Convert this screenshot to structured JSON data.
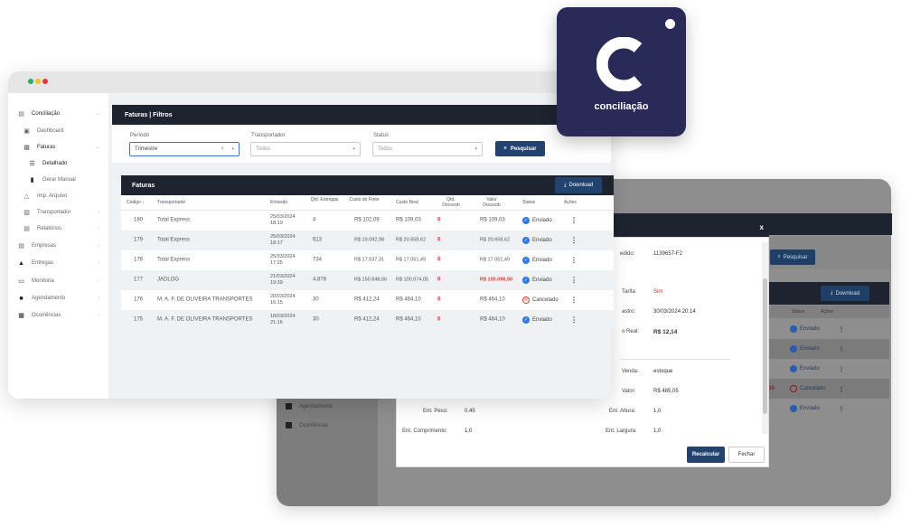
{
  "logo": {
    "text": "conciliação"
  },
  "sidebar": {
    "items": [
      {
        "label": "Conciliação",
        "icon": "ledger-icon"
      },
      {
        "label": "Dashboard",
        "icon": "dashboard-icon"
      },
      {
        "label": "Faturas",
        "icon": "folder-icon"
      },
      {
        "label": "Detalhado",
        "icon": "list-icon"
      },
      {
        "label": "Gerar Manual",
        "icon": "document-icon"
      },
      {
        "label": "Imp. Arquivo",
        "icon": "upload-icon"
      },
      {
        "label": "Transportador",
        "icon": "truck-icon"
      },
      {
        "label": "Relatórios",
        "icon": "report-icon"
      },
      {
        "label": "Empresas",
        "icon": "building-icon"
      },
      {
        "label": "Entregas",
        "icon": "delivery-icon"
      },
      {
        "label": "Monitoria",
        "icon": "monitor-icon"
      },
      {
        "label": "Agendamento",
        "icon": "calendar-icon"
      },
      {
        "label": "Ocorrências",
        "icon": "grid-icon"
      }
    ]
  },
  "filters": {
    "title": "Faturas | Filtros",
    "periodo_label": "Período",
    "periodo_value": "Trimestre",
    "transportador_label": "Transportador",
    "transportador_value": "Todos",
    "status_label": "Status",
    "status_value": "Todos",
    "search_button": "Pesquisar"
  },
  "faturas": {
    "title": "Faturas",
    "download_button": "Download",
    "columns": [
      "Codigo",
      "Transportador",
      "Emissão",
      "Qtd. Entregas",
      "Custo do Frete",
      "Custo Real",
      "Qtd. Docscob",
      "Valor Docscob",
      "Status",
      "Ações"
    ],
    "rows": [
      {
        "codigo": "180",
        "transportador": "Total Express",
        "emissao": "25/03/2024 18:19",
        "qtd": "4",
        "custo_frete": "R$ 102,09",
        "custo_real": "R$ 109,03",
        "docs": "0",
        "valor": "R$ 109,03",
        "status": "Enviado"
      },
      {
        "codigo": "179",
        "transportador": "Total Express",
        "emissao": "25/03/2024 18:17",
        "qtd": "613",
        "custo_frete": "R$ 19.092,98",
        "custo_real": "R$ 20.658,62",
        "docs": "0",
        "valor": "R$ 20.658,62",
        "status": "Enviado"
      },
      {
        "codigo": "178",
        "transportador": "Total Express",
        "emissao": "25/03/2024 17:25",
        "qtd": "734",
        "custo_frete": "R$ 17.537,31",
        "custo_real": "R$ 17.051,49",
        "docs": "0",
        "valor": "R$ 17.051,49",
        "status": "Enviado"
      },
      {
        "codigo": "177",
        "transportador": "JADLOG",
        "emissao": "21/03/2024 19:39",
        "qtd": "4.878",
        "custo_frete": "R$ 150.848,66",
        "custo_real": "R$ 100.074,05",
        "docs": "0",
        "valor": "R$ 100.096,50",
        "status": "Enviado"
      },
      {
        "codigo": "176",
        "transportador": "M. A. F. DE OLIVEIRA TRANSPORTES",
        "emissao": "20/03/2024 16:15",
        "qtd": "30",
        "custo_frete": "R$ 412,24",
        "custo_real": "R$ 464,10",
        "docs": "0",
        "valor": "R$ 464,10",
        "status": "Cancelado"
      },
      {
        "codigo": "175",
        "transportador": "M. A. F. DE OLIVEIRA TRANSPORTES",
        "emissao": "18/03/2024 21:16",
        "qtd": "30",
        "custo_frete": "R$ 412,24",
        "custo_real": "R$ 464,10",
        "docs": "0",
        "valor": "R$ 464,10",
        "status": "Enviado"
      }
    ]
  },
  "back_window": {
    "search_button": "Pesquisar",
    "download_button": "Download",
    "col_status": "Status",
    "col_acoes": "Ações",
    "sidebar_agendamento": "Agendamento",
    "sidebar_ocorrencias": "Ocorrências",
    "statuses": [
      "Enviado",
      "Enviado",
      "Enviado",
      "Cancelado",
      "Enviado"
    ],
    "red_fragment": "50"
  },
  "modal": {
    "close": "x",
    "pedido_label": "edido:",
    "pedido_value": "1139657-F2",
    "tarifa_label": "Tarifa:",
    "tarifa_value": "Sim",
    "cadastro_label": "astro:",
    "cadastro_value": "30/03/2024 20:14",
    "real_label": "o Real:",
    "real_value": "R$ 12,14",
    "venda_label": "Venda:",
    "venda_value": "estoque",
    "valor_label": "Valor:",
    "valor_value": "R$ 485,05",
    "peso_label": "Ent. Peso:",
    "peso_value": "0,45",
    "altura_label": "Ent. Altura:",
    "altura_value": "1,0",
    "comprimento_label": "Ent. Comprimento:",
    "comprimento_value": "1,0",
    "largura_label": "Ent. Largura:",
    "largura_value": "1,0",
    "recalcular_button": "Recalcular",
    "fechar_button": "Fechar"
  },
  "colors": {
    "navy": "#1d2430",
    "button_blue": "#23426d",
    "logo_bg": "#2a2a58",
    "status_blue": "#2f7ae5",
    "alert_red": "#e53935"
  }
}
